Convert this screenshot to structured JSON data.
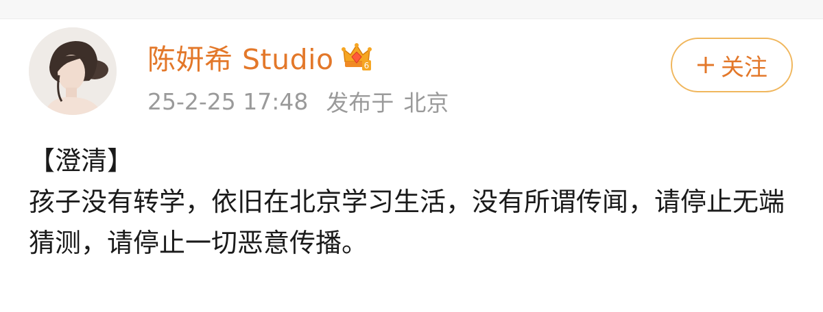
{
  "post": {
    "author": "陈妍希 Studio",
    "timestamp": "25-2-25 17:48",
    "location_label": "发布于",
    "location": "北京",
    "follow_label": "关注",
    "vip_badge": {
      "icon": "crown-badge-icon",
      "level": "6"
    },
    "content": {
      "title": "【澄清】",
      "body": "孩子没有转学，依旧在北京学习生活，没有所谓传闻，请停止无端猜测，请停止一切恶意传播。"
    }
  },
  "colors": {
    "username": "#e3782a",
    "follow_border": "#f0b65c",
    "meta_text": "#9a9a9a",
    "body_text": "#1a1a1a"
  }
}
